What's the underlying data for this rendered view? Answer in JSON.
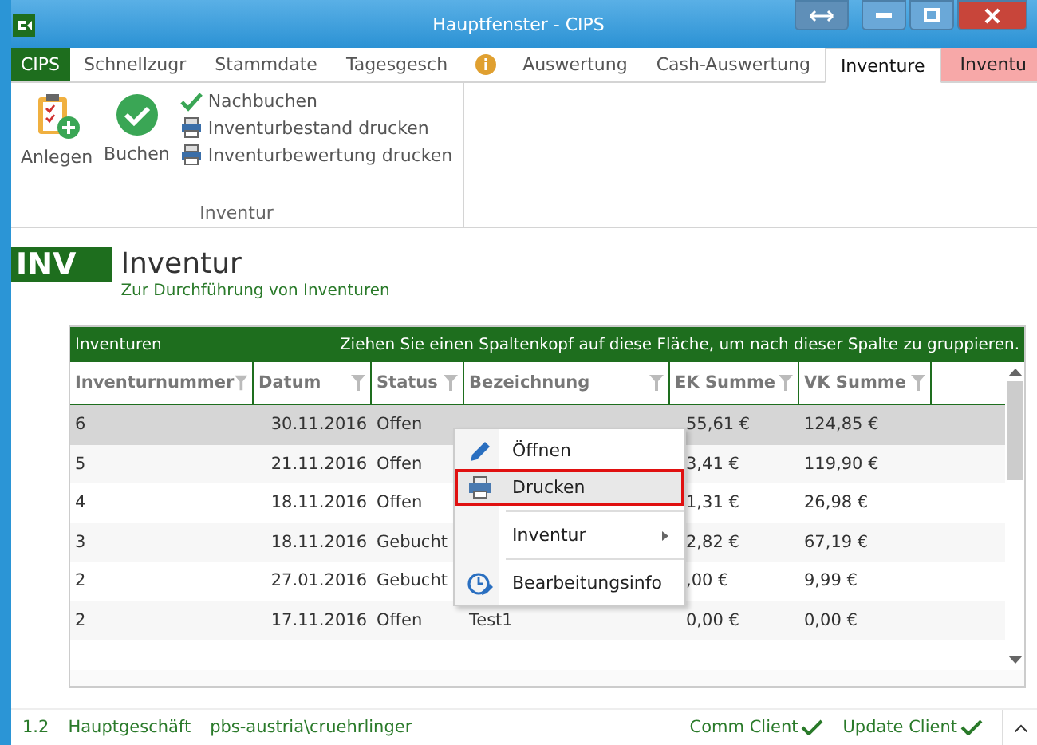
{
  "window": {
    "title": "Hauptfenster - CIPS"
  },
  "tabs": [
    {
      "label": "CIPS",
      "kind": "app",
      "selected": false
    },
    {
      "label": "Schnellzugr",
      "kind": "tab",
      "selected": false
    },
    {
      "label": "Stammdate",
      "kind": "tab",
      "selected": false
    },
    {
      "label": "Tagesgesch",
      "kind": "tab",
      "selected": false
    },
    {
      "kind": "info",
      "selected": false
    },
    {
      "label": "Auswertung",
      "kind": "tab",
      "selected": false
    },
    {
      "label": "Cash-Auswertung",
      "kind": "tab",
      "selected": false
    },
    {
      "label": "Inventure",
      "kind": "tab",
      "selected": true
    },
    {
      "label": "Inventu",
      "kind": "context",
      "selected": false
    }
  ],
  "ribbon": {
    "big_buttons": [
      {
        "label": "Anlegen",
        "kind": "add"
      },
      {
        "label": "Buchen",
        "kind": "check"
      }
    ],
    "small_buttons": [
      {
        "label": "Nachbuchen",
        "kind": "check"
      },
      {
        "label": "Inventurbestand drucken",
        "kind": "print"
      },
      {
        "label": "Inventurbewertung drucken",
        "kind": "print"
      }
    ],
    "group": "Inventur"
  },
  "header": {
    "badge": "INV",
    "title": "Inventur",
    "subtitle": "Zur Durchführung von Inventuren"
  },
  "table": {
    "title": "Inventuren",
    "group_hint": "Ziehen Sie einen Spaltenkopf auf diese Fläche, um nach dieser Spalte zu gruppieren.",
    "columns": [
      "Inventurnummer",
      "Datum",
      "Status",
      "Bezeichnung",
      "EK Summe",
      "VK Summe"
    ],
    "rows": [
      {
        "cells": [
          "6",
          "30.11.2016",
          "Offen",
          "",
          "55,61 €",
          "124,85 €"
        ],
        "selected": true
      },
      {
        "cells": [
          "5",
          "21.11.2016",
          "Offen",
          "",
          "3,41 €",
          "119,90 €"
        ],
        "selected": false
      },
      {
        "cells": [
          "4",
          "18.11.2016",
          "Offen",
          "",
          "1,31 €",
          "26,98 €"
        ],
        "selected": false
      },
      {
        "cells": [
          "3",
          "18.11.2016",
          "Gebucht",
          "",
          "2,82 €",
          "67,19 €"
        ],
        "selected": false
      },
      {
        "cells": [
          "2",
          "27.01.2016",
          "Gebucht",
          "",
          ",00 €",
          "9,99 €"
        ],
        "selected": false
      },
      {
        "cells": [
          "2",
          "17.11.2016",
          "Offen",
          "Test1",
          "0,00 €",
          "0,00 €"
        ],
        "selected": false
      }
    ]
  },
  "context_menu": [
    {
      "label": "Öffnen",
      "kind": "edit",
      "submenu": false,
      "selected": false
    },
    {
      "label": "Drucken",
      "kind": "print",
      "submenu": false,
      "selected": true
    },
    {
      "label": "Inventur",
      "kind": "group",
      "submenu": true,
      "selected": false
    },
    {
      "label": "Bearbeitungsinfo",
      "kind": "history",
      "submenu": false,
      "selected": false
    }
  ],
  "status_bar": {
    "version": "1.2",
    "branch": "Hauptgeschäft",
    "user": "pbs-austria\\cruehrlinger",
    "services": [
      "Comm Client",
      "Update Client"
    ]
  }
}
